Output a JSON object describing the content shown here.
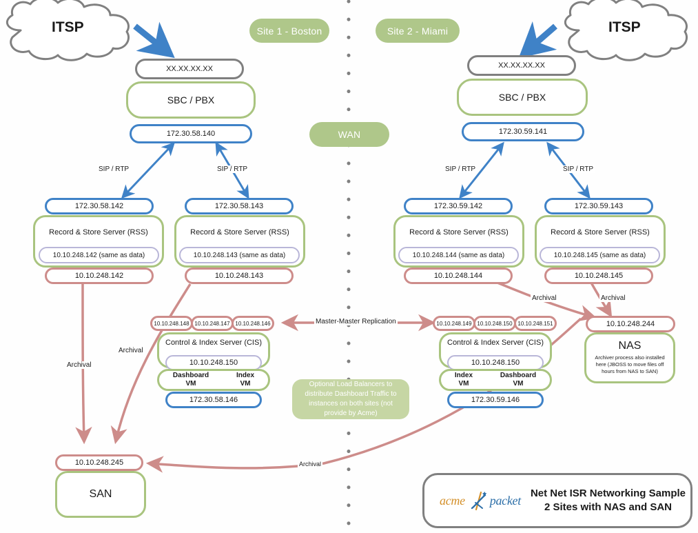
{
  "title_box": {
    "logo_acme": "acme",
    "logo_packet": "packet",
    "line1": "Net Net ISR Networking Sample",
    "line2": "2 Sites with NAS and SAN"
  },
  "site_labels": {
    "site1": "Site 1 - Boston",
    "site2": "Site 2 - Miami",
    "wan": "WAN"
  },
  "clouds": {
    "left": "ITSP",
    "right": "ITSP"
  },
  "colors": {
    "green": "#a9c47f",
    "blue": "#3f82c7",
    "red": "#cd8c8a",
    "purple": "#b9b6d8",
    "gray": "#7f7f7f",
    "badge_green": "#afc78a",
    "note_green": "#c6d6a4",
    "logo_orange": "#d4902a",
    "logo_blue": "#2d6fa8"
  },
  "site1": {
    "sbc": {
      "public_ip": "XX.XX.XX.XX",
      "name": "SBC / PBX",
      "lan_ip": "172.30.58.140"
    },
    "rss": [
      {
        "sig_ip": "172.30.58.142",
        "name": "Record & Store Server (RSS)",
        "mgmt_ip": "10.10.248.142 (same as data)",
        "data_ip": "10.10.248.142"
      },
      {
        "sig_ip": "172.30.58.143",
        "name": "Record & Store Server (RSS)",
        "mgmt_ip": "10.10.248.143 (same as data)",
        "data_ip": "10.10.248.143"
      }
    ],
    "cis": {
      "chips": [
        "10.10.248.148",
        "10.10.248.147",
        "10.10.248.146"
      ],
      "name": "Control & Index Server (CIS)",
      "mgmt_ip": "10.10.248.150",
      "vms": [
        "Dashboard\nVM",
        "Index\nVM"
      ],
      "vm_left_l1": "Dashboard",
      "vm_left_l2": "VM",
      "vm_right_l1": "Index",
      "vm_right_l2": "VM",
      "net_ip": "172.30.58.146"
    },
    "san": {
      "ip": "10.10.248.245",
      "name": "SAN"
    }
  },
  "site2": {
    "sbc": {
      "public_ip": "XX.XX.XX.XX",
      "name": "SBC / PBX",
      "lan_ip": "172.30.59.141"
    },
    "rss": [
      {
        "sig_ip": "172.30.59.142",
        "name": "Record & Store Server (RSS)",
        "mgmt_ip": "10.10.248.144 (same as data)",
        "data_ip": "10.10.248.144"
      },
      {
        "sig_ip": "172.30.59.143",
        "name": "Record & Store Server (RSS)",
        "mgmt_ip": "10.10.248.145 (same as data)",
        "data_ip": "10.10.248.145"
      }
    ],
    "cis": {
      "chips": [
        "10.10.248.149",
        "10.10.248.150",
        "10.10.248.151"
      ],
      "name": "Control & Index Server (CIS)",
      "mgmt_ip": "10.10.248.150",
      "vm_left_l1": "Index",
      "vm_left_l2": "VM",
      "vm_right_l1": "Dashboard",
      "vm_right_l2": "VM",
      "net_ip": "172.30.59.146"
    },
    "nas": {
      "ip": "10.10.248.244",
      "name": "NAS",
      "note": "Archiver process also installed here (JBOSS to move files off hours from NAS to SAN)"
    }
  },
  "edge_labels": {
    "sip_rtp": "SIP / RTP",
    "archival": "Archival",
    "replication": "Master-Master Replication"
  },
  "lb_note": "Optional Load Balancers to distribute Dashboard Traffic to instances on both sites (not provide by Acme)"
}
